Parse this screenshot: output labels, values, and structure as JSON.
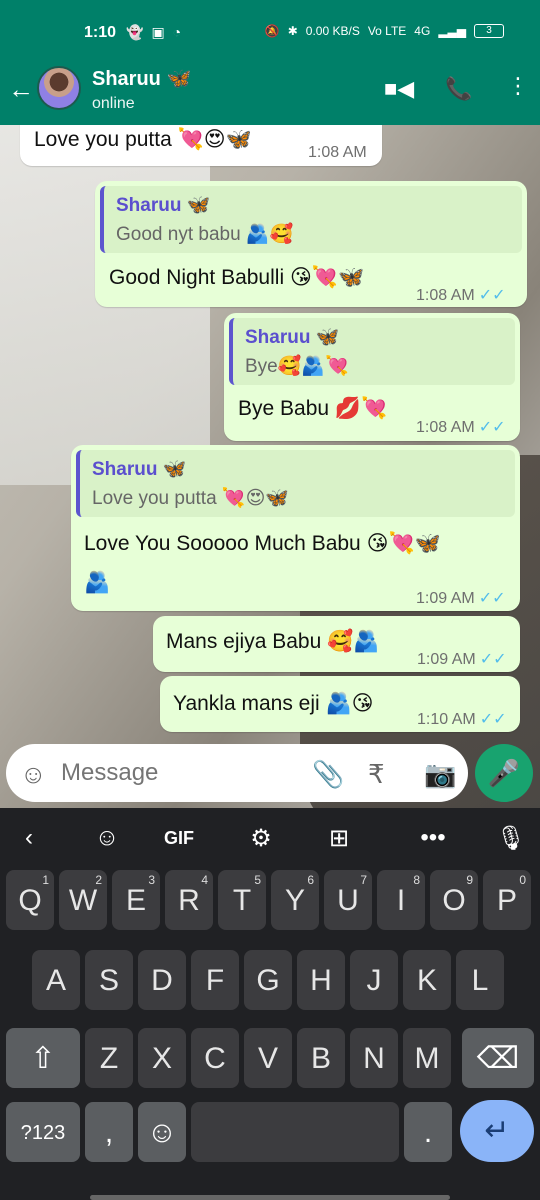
{
  "status_bar": {
    "time": "1:10",
    "left_icons": [
      "snapchat",
      "phone-cleaner",
      "whatsapp"
    ],
    "network_speed": "0.00 KB/S",
    "volte": "Vo LTE",
    "signal": "4G",
    "battery": "3"
  },
  "header": {
    "contact_name": "Sharuu 🦋",
    "status": "online",
    "back_icon": "arrow-back-icon",
    "video_icon": "video-call-icon",
    "call_icon": "phone-call-icon",
    "menu_icon": "more-options-icon"
  },
  "messages": [
    {
      "direction": "incoming",
      "text": "Love you putta 💘😍🦋",
      "time": "1:08 AM"
    },
    {
      "direction": "outgoing",
      "quote_author": "Sharuu 🦋",
      "quote_text": "Good nyt babu 🫂🥰",
      "text": "Good Night Babulli 😘💘🦋",
      "time": "1:08 AM",
      "status": "✓✓"
    },
    {
      "direction": "outgoing",
      "quote_author": "Sharuu 🦋",
      "quote_text": "Bye🥰🫂💘",
      "text": "Bye Babu 💋💘",
      "time": "1:08 AM",
      "status": "✓✓"
    },
    {
      "direction": "outgoing",
      "quote_author": "Sharuu 🦋",
      "quote_text": "Love you putta 💘😍🦋",
      "text": "Love You Sooooo Much Babu 😘💘🦋",
      "text_line2": "🫂",
      "time": "1:09 AM",
      "status": "✓✓"
    },
    {
      "direction": "outgoing",
      "text": "Mans ejiya Babu 🥰🫂",
      "time": "1:09 AM",
      "status": "✓✓"
    },
    {
      "direction": "outgoing",
      "text": "Yankla mans eji 🫂😘",
      "time": "1:10 AM",
      "status": "✓✓"
    }
  ],
  "composer": {
    "placeholder": "Message",
    "emoji_icon": "emoji-icon",
    "attach_icon": "attach-icon",
    "payment_icon": "rupee-payment-icon",
    "camera_icon": "camera-icon",
    "mic_icon": "microphone-icon"
  },
  "keyboard": {
    "toolbar": [
      {
        "name": "chevron-left-icon",
        "glyph": "‹"
      },
      {
        "name": "sticker-icon",
        "glyph": "☺"
      },
      {
        "name": "gif-button",
        "glyph": "GIF"
      },
      {
        "name": "settings-icon",
        "glyph": "⚙"
      },
      {
        "name": "translate-icon",
        "glyph": "⊞"
      },
      {
        "name": "more-icon",
        "glyph": "•••"
      },
      {
        "name": "voice-input-icon",
        "glyph": "🎙"
      }
    ],
    "row1": [
      {
        "label": "Q",
        "hint": "1"
      },
      {
        "label": "W",
        "hint": "2"
      },
      {
        "label": "E",
        "hint": "3"
      },
      {
        "label": "R",
        "hint": "4"
      },
      {
        "label": "T",
        "hint": "5"
      },
      {
        "label": "Y",
        "hint": "6"
      },
      {
        "label": "U",
        "hint": "7"
      },
      {
        "label": "I",
        "hint": "8"
      },
      {
        "label": "O",
        "hint": "9"
      },
      {
        "label": "P",
        "hint": "0"
      }
    ],
    "row2": [
      "A",
      "S",
      "D",
      "F",
      "G",
      "H",
      "J",
      "K",
      "L"
    ],
    "row3": [
      "Z",
      "X",
      "C",
      "V",
      "B",
      "N",
      "M"
    ],
    "shift": "⇧",
    "backspace": "⌫",
    "numbers": "?123",
    "comma": ",",
    "emoji_key": "☺",
    "period": ".",
    "enter": "↵"
  },
  "colors": {
    "header": "#008069",
    "outgoing_bubble": "#e7ffd7",
    "incoming_bubble": "#ffffff",
    "quote_accent": "#5c55ce",
    "read_ticks": "#53bdeb"
  }
}
